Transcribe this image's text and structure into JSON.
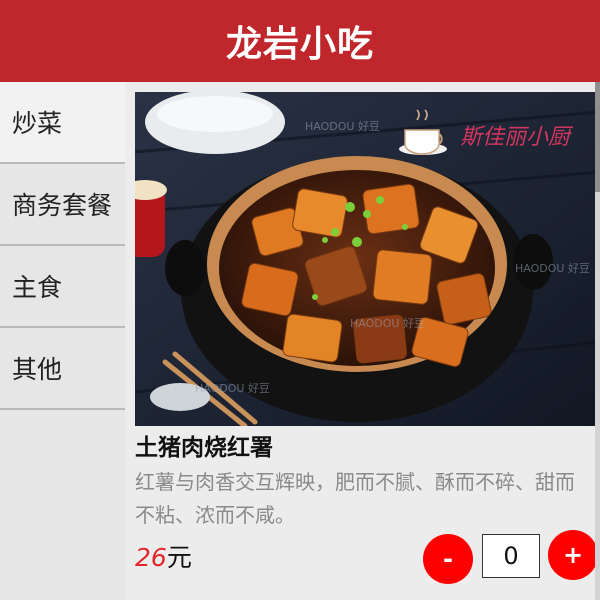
{
  "app": {
    "title": "龙岩小吃"
  },
  "sidebar": {
    "items": [
      {
        "label": "炒菜"
      },
      {
        "label": "商务套餐"
      },
      {
        "label": "主食"
      },
      {
        "label": "其他"
      }
    ]
  },
  "dish": {
    "name": "土猪肉烧红署",
    "description": "红薯与肉香交互辉映，肥而不腻、酥而不碎、甜而不粘、浓而不咸。",
    "price_value": "26",
    "price_unit": "元",
    "quantity": "0",
    "minus_label": "-",
    "plus_label": "+",
    "photo_watermark": "HAODOU 好豆",
    "photo_logo_text": "斯佳丽小厨"
  },
  "colors": {
    "header_bg": "#c0272d",
    "price_accent": "#e4252b",
    "button_red": "#ff0000"
  }
}
